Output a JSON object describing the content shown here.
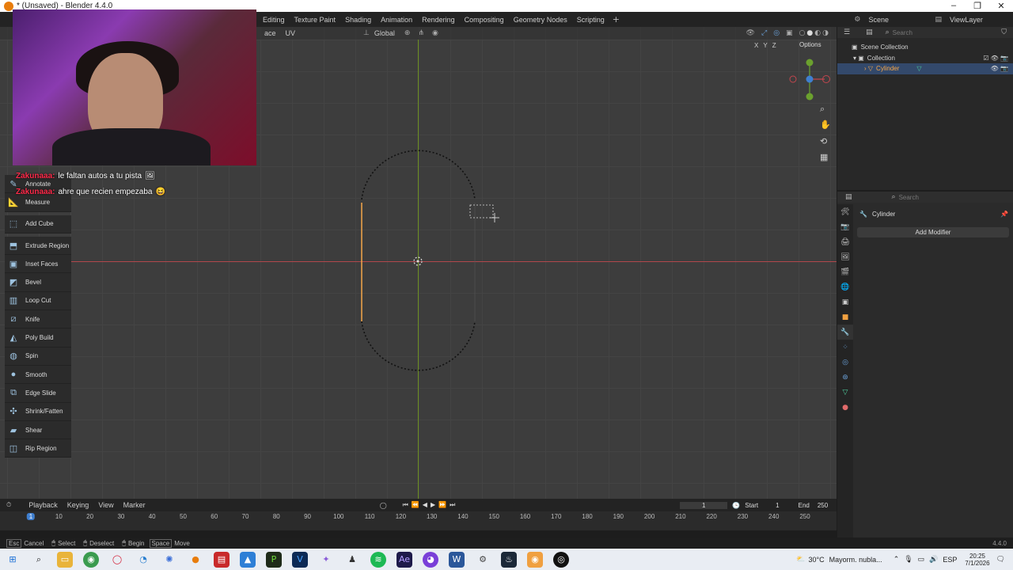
{
  "window": {
    "title": "* (Unsaved) - Blender 4.4.0",
    "controls": [
      "–",
      "❐",
      "✕"
    ]
  },
  "topbar": {
    "tabs": [
      "Editing",
      "Texture Paint",
      "Shading",
      "Animation",
      "Rendering",
      "Compositing",
      "Geometry Nodes",
      "Scripting"
    ],
    "add": "+",
    "scene": "Scene",
    "view_layer": "ViewLayer"
  },
  "viewport_header": {
    "menu_items": [
      "ace",
      "UV"
    ],
    "orientation": "Global",
    "options": "Options",
    "axis_lock": [
      "X",
      "Y",
      "Z"
    ]
  },
  "toolbar": {
    "items": [
      "Annotate",
      "Measure",
      "Add Cube",
      "Extrude Region",
      "Inset Faces",
      "Bevel",
      "Loop Cut",
      "Knife",
      "Poly Build",
      "Spin",
      "Smooth",
      "Edge Slide",
      "Shrink/Fatten",
      "Shear",
      "Rip Region"
    ]
  },
  "chat": [
    {
      "user": "Zakunaaa:",
      "message": "le faltan autos a tu pista"
    },
    {
      "user": "Zakunaaa:",
      "message": "ahre que recien empezaba"
    }
  ],
  "outliner": {
    "search_placeholder": "Search",
    "rows": [
      "Scene Collection",
      "Collection",
      "Cylinder"
    ]
  },
  "properties": {
    "search_placeholder": "Search",
    "object_name": "Cylinder",
    "add_modifier": "Add Modifier"
  },
  "timeline": {
    "menus": [
      "Playback",
      "Keying",
      "View",
      "Marker"
    ],
    "current_frame": "1",
    "start_label": "Start",
    "start": "1",
    "end_label": "End",
    "end": "250",
    "ticks": [
      "10",
      "20",
      "30",
      "40",
      "50",
      "60",
      "70",
      "80",
      "90",
      "100",
      "110",
      "120",
      "130",
      "140",
      "150",
      "160",
      "170",
      "180",
      "190",
      "200",
      "210",
      "220",
      "230",
      "240",
      "250"
    ],
    "playhead": "1"
  },
  "statusbar": {
    "items": [
      "Esc",
      "Cancel",
      "Select",
      "Deselect",
      "Begin",
      "Space",
      "Move"
    ],
    "version": "4.4.0"
  },
  "taskbar": {
    "weather": "30°C",
    "weather_desc": "Mayorm. nubla...",
    "lang": "ESP",
    "time": "20:25",
    "date": "7/1/2026"
  },
  "colors": {
    "viewport_bg": "#3d3d3d",
    "x_axis": "#b0474c",
    "y_axis": "#6b8f21",
    "selected_edge": "#f5a64a",
    "selection_row": "#33496b"
  }
}
